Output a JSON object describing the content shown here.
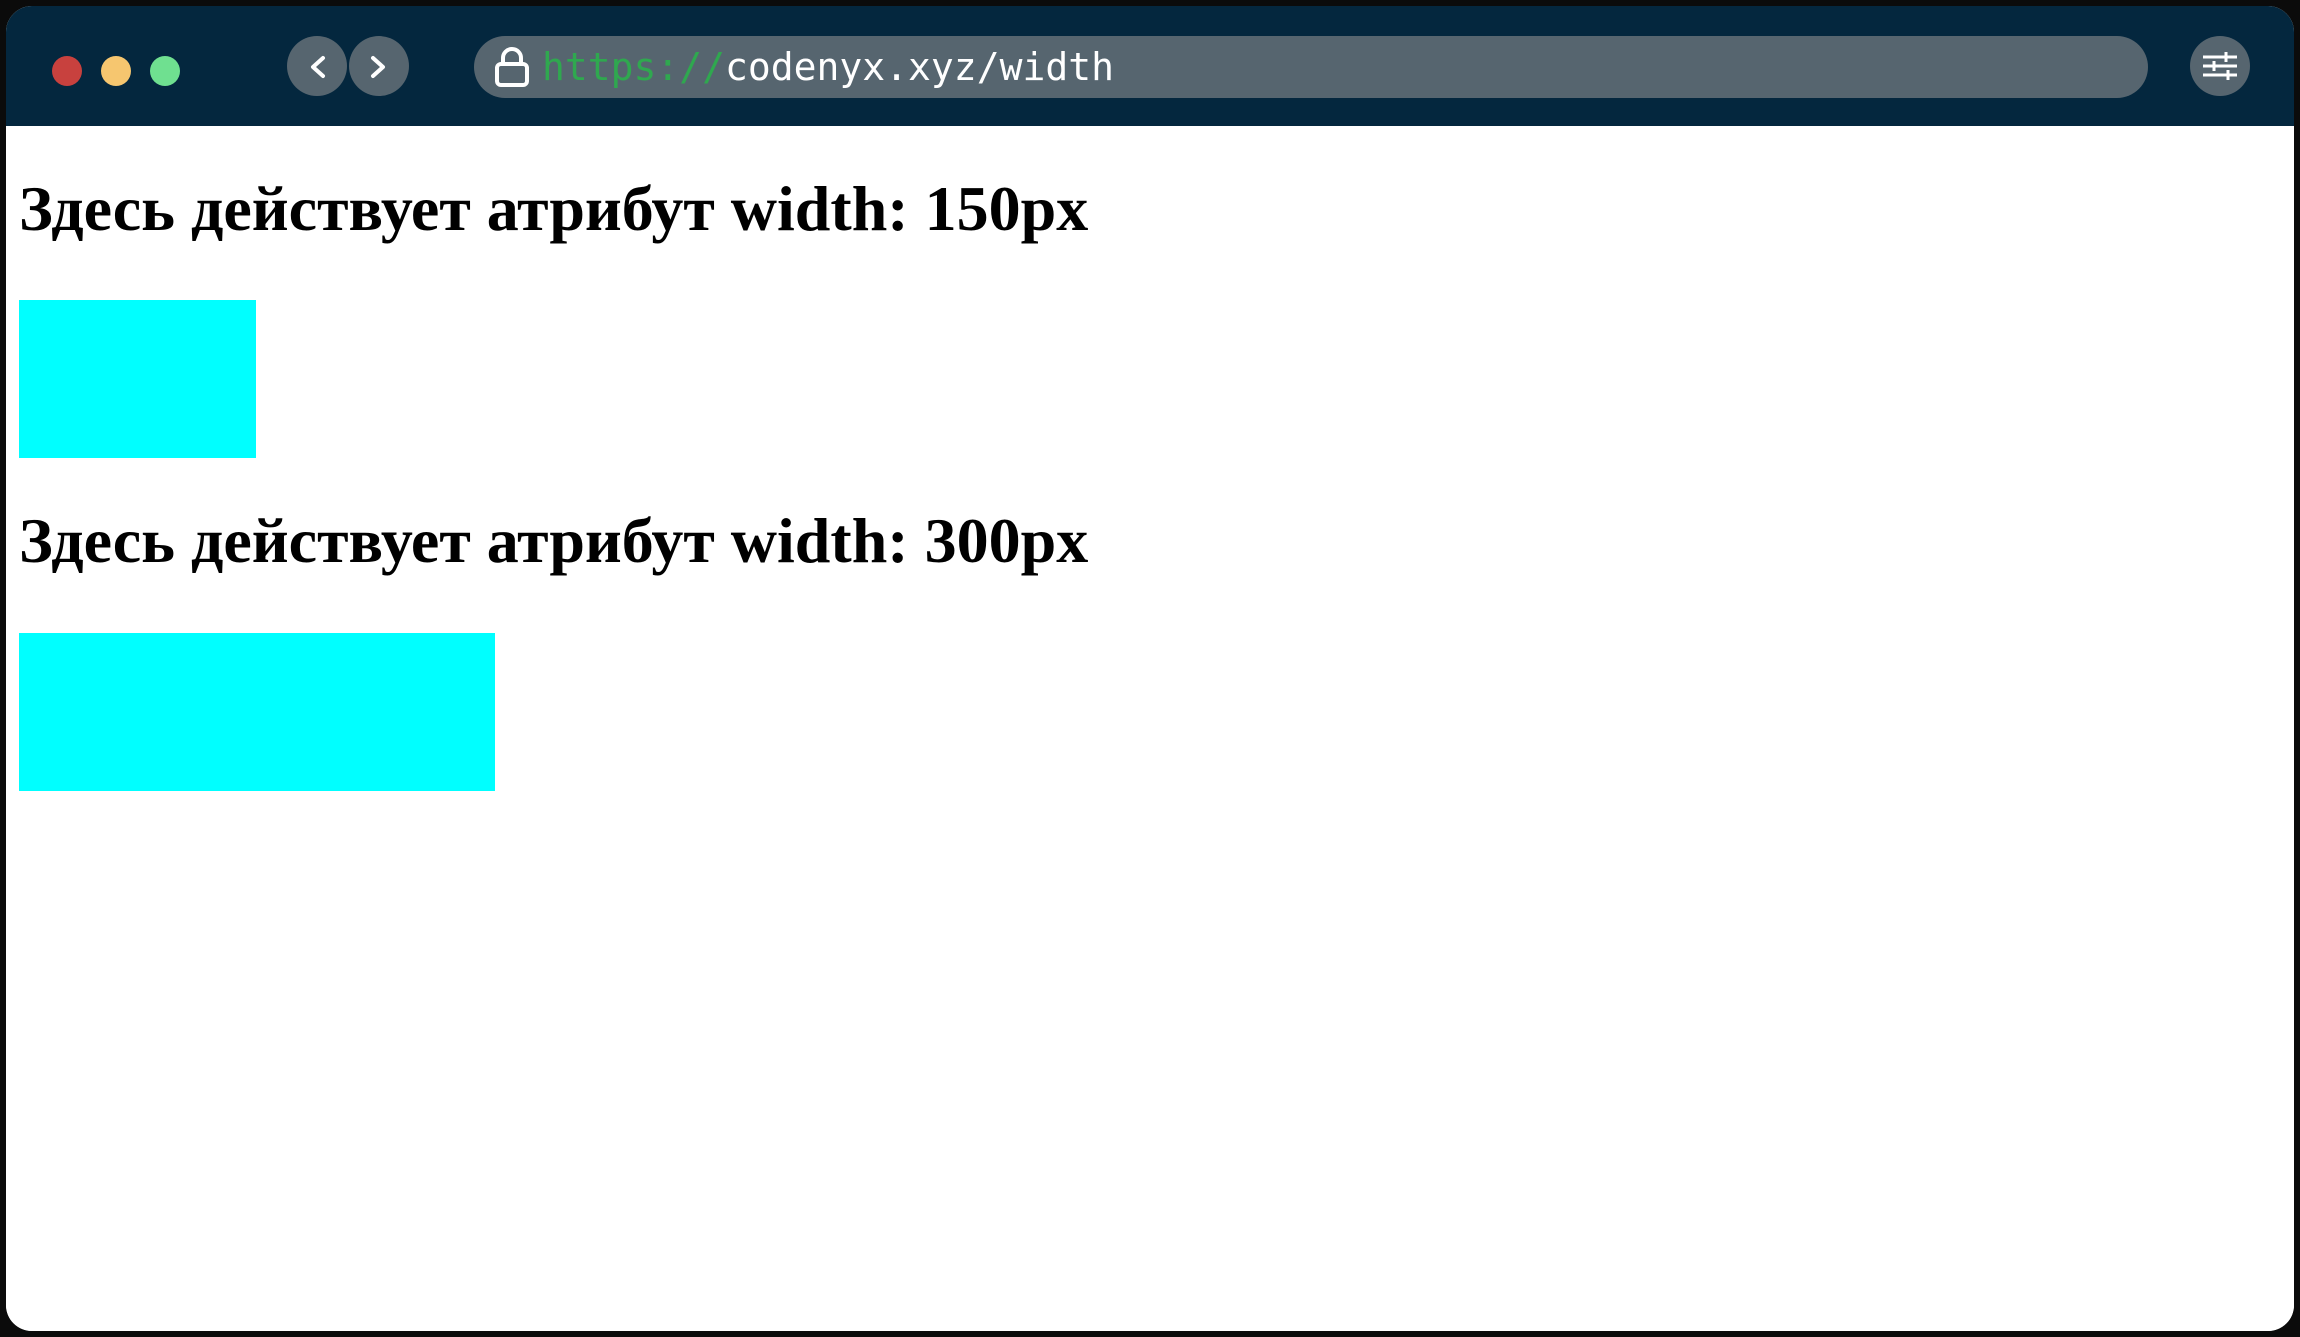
{
  "browser": {
    "url_scheme": "https://",
    "url_rest": "codenyx.xyz/width",
    "icons": {
      "back": "chevron-left-icon",
      "forward": "chevron-right-icon",
      "lock": "lock-icon",
      "menu": "sliders-icon"
    },
    "colors": {
      "titlebar": "#04273e",
      "control": "#56656f",
      "scheme": "#2fa84f",
      "close": "#c8413e",
      "minimize": "#f6c66f",
      "maximize": "#6fe090"
    }
  },
  "page": {
    "blocks": [
      {
        "heading": "Здесь действует атрибут width: 150px",
        "box_color": "#00ffff"
      },
      {
        "heading": "Здесь действует атрибут width: 300px",
        "box_color": "#00ffff"
      }
    ]
  }
}
